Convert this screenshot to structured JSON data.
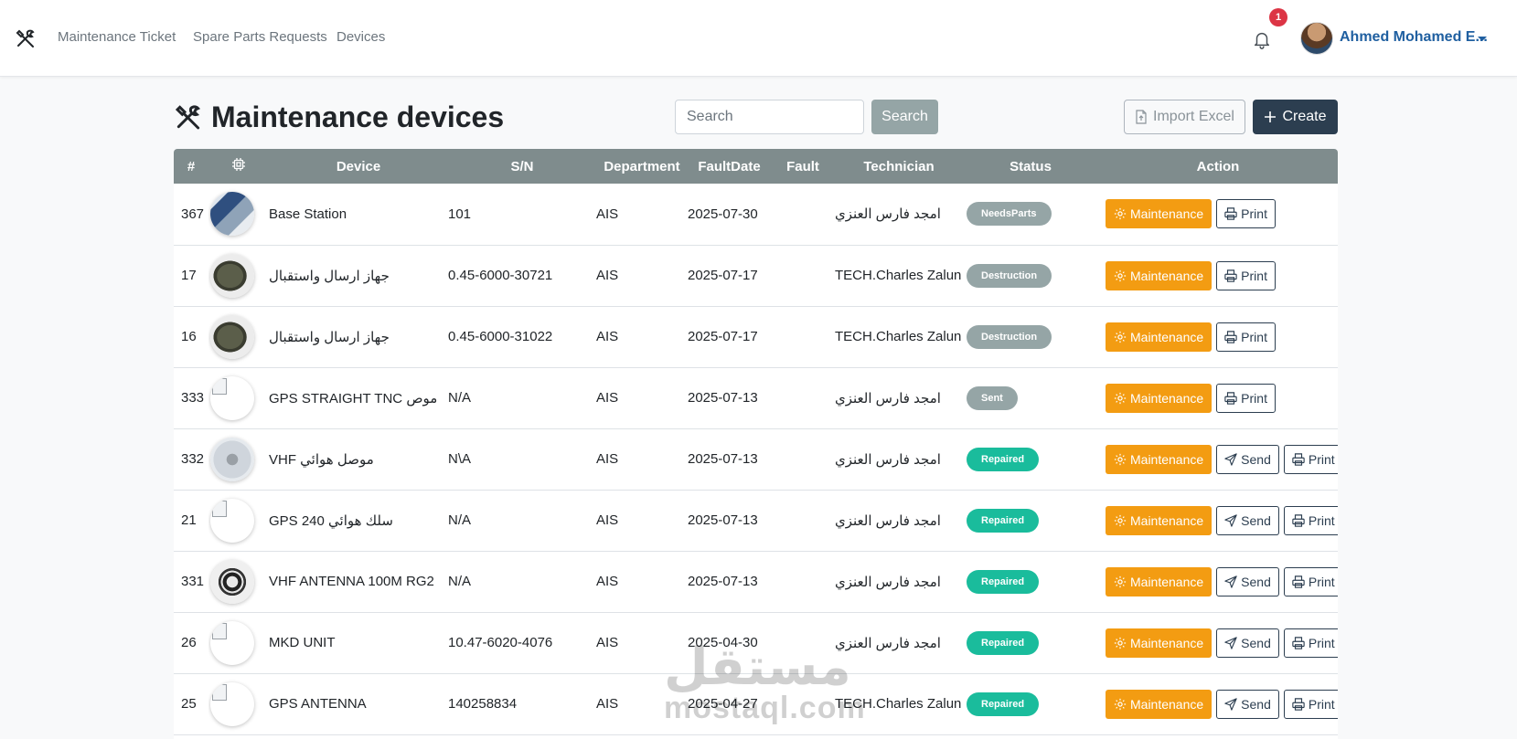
{
  "nav": {
    "items": [
      "Maintenance Ticket",
      "Spare Parts Requests",
      "Devices"
    ],
    "notification_count": "1",
    "user_name": "Ahmed Mohamed E...",
    "brand_icon": "tools-icon"
  },
  "page": {
    "title": "Maintenance devices",
    "search_placeholder": "Search",
    "search_label": "Search",
    "import_label": "Import Excel",
    "create_label": "Create"
  },
  "table": {
    "headers": [
      "#",
      "",
      "Device",
      "S/N",
      "Department",
      "FaultDate",
      "Fault",
      "Technician",
      "Status",
      "Action"
    ],
    "image_header_icon": "chip-icon",
    "rows": [
      {
        "id": "367",
        "image": "base",
        "device": "Base Station",
        "sn": "101",
        "department": "AIS",
        "fault_date": "2025-07-30",
        "fault": "",
        "technician": "امجد فارس العنزي",
        "status": "NeedsParts",
        "actions": [
          "Maintenance",
          "Print"
        ]
      },
      {
        "id": "17",
        "image": "box",
        "device": "جهاز ارسال واستقبال",
        "sn": "0.45-6000-30721",
        "department": "AIS",
        "fault_date": "2025-07-17",
        "fault": "",
        "technician": "TECH.Charles Zalun",
        "status": "Destruction",
        "actions": [
          "Maintenance",
          "Print"
        ]
      },
      {
        "id": "16",
        "image": "box",
        "device": "جهاز ارسال واستقبال",
        "sn": "0.45-6000-31022",
        "department": "AIS",
        "fault_date": "2025-07-17",
        "fault": "",
        "technician": "TECH.Charles Zalun",
        "status": "Destruction",
        "actions": [
          "Maintenance",
          "Print"
        ]
      },
      {
        "id": "333",
        "image": "broken",
        "device": "GPS STRAIGHT TNC موص",
        "sn": "N/A",
        "department": "AIS",
        "fault_date": "2025-07-13",
        "fault": "",
        "technician": "امجد فارس العنزي",
        "status": "Sent",
        "actions": [
          "Maintenance",
          "Print"
        ]
      },
      {
        "id": "332",
        "image": "conn",
        "device": "VHF موصل هوائي",
        "sn": "N\\A",
        "department": "AIS",
        "fault_date": "2025-07-13",
        "fault": "",
        "technician": "امجد فارس العنزي",
        "status": "Repaired",
        "actions": [
          "Maintenance",
          "Send",
          "Print"
        ]
      },
      {
        "id": "21",
        "image": "broken",
        "device": "GPS 240 سلك هوائي",
        "sn": "N/A",
        "department": "AIS",
        "fault_date": "2025-07-13",
        "fault": "",
        "technician": "امجد فارس العنزي",
        "status": "Repaired",
        "actions": [
          "Maintenance",
          "Send",
          "Print"
        ]
      },
      {
        "id": "331",
        "image": "cable",
        "device": "VHF ANTENNA 100M RG2",
        "sn": "N/A",
        "department": "AIS",
        "fault_date": "2025-07-13",
        "fault": "",
        "technician": "امجد فارس العنزي",
        "status": "Repaired",
        "actions": [
          "Maintenance",
          "Send",
          "Print"
        ]
      },
      {
        "id": "26",
        "image": "broken",
        "device": "MKD UNIT",
        "sn": "10.47-6020-4076",
        "department": "AIS",
        "fault_date": "2025-04-30",
        "fault": "",
        "technician": "امجد فارس العنزي",
        "status": "Repaired",
        "actions": [
          "Maintenance",
          "Send",
          "Print"
        ]
      },
      {
        "id": "25",
        "image": "broken",
        "device": "GPS ANTENNA",
        "sn": "140258834",
        "department": "AIS",
        "fault_date": "2025-04-27",
        "fault": "",
        "technician": "TECH.Charles Zalun",
        "status": "Repaired",
        "actions": [
          "Maintenance",
          "Send",
          "Print"
        ]
      }
    ]
  },
  "status_colors": {
    "NeedsParts": "#95a5a6",
    "Destruction": "#95a5a6",
    "Sent": "#95a5a6",
    "Repaired": "#1abc9c"
  },
  "colors": {
    "maintenance": "#f39c12",
    "primary": "#2c3e50",
    "table_header": "#7f8c8d",
    "user_link": "#1f5fa0",
    "notification": "#dc3545"
  },
  "watermark": {
    "arabic": "مستقل",
    "latin": "mostaql.com"
  }
}
